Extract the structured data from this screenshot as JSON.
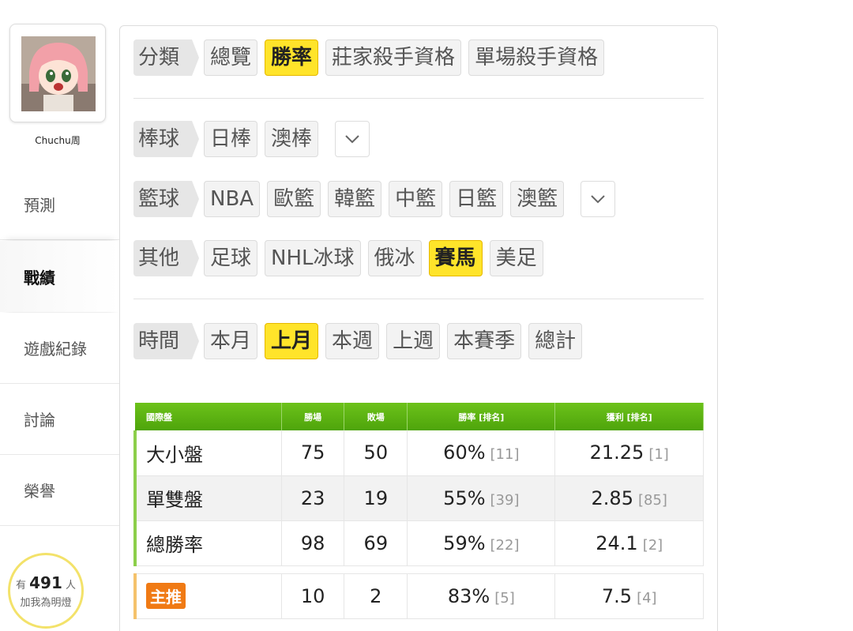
{
  "profile": {
    "username": "Chuchu周"
  },
  "nav": [
    {
      "label": "預測",
      "active": false
    },
    {
      "label": "戰績",
      "active": true
    },
    {
      "label": "遊戲紀錄",
      "active": false
    },
    {
      "label": "討論",
      "active": false
    },
    {
      "label": "榮譽",
      "active": false
    }
  ],
  "fans": {
    "prefix": "有",
    "count": "491",
    "suffix": "人",
    "line2": "加我為明燈"
  },
  "filters": {
    "category": {
      "label": "分類",
      "options": [
        "總覽",
        "勝率",
        "莊家殺手資格",
        "單場殺手資格"
      ],
      "selected": "勝率"
    },
    "baseball": {
      "label": "棒球",
      "options": [
        "日棒",
        "澳棒"
      ]
    },
    "basketball": {
      "label": "籃球",
      "options": [
        "NBA",
        "歐籃",
        "韓籃",
        "中籃",
        "日籃",
        "澳籃"
      ]
    },
    "other": {
      "label": "其他",
      "options": [
        "足球",
        "NHL冰球",
        "俄冰",
        "賽馬",
        "美足"
      ],
      "selected": "賽馬"
    },
    "time": {
      "label": "時間",
      "options": [
        "本月",
        "上月",
        "本週",
        "上週",
        "本賽季",
        "總計"
      ],
      "selected": "上月"
    }
  },
  "table": {
    "headers": [
      "國際盤",
      "勝場",
      "敗場",
      "勝率 [排名]",
      "獲利 [排名]"
    ],
    "rows": [
      {
        "name": "大小盤",
        "win": "75",
        "loss": "50",
        "rate": "60%",
        "rate_rank": "[11]",
        "profit": "21.25",
        "profit_rank": "[1]"
      },
      {
        "name": "單雙盤",
        "win": "23",
        "loss": "19",
        "rate": "55%",
        "rate_rank": "[39]",
        "profit": "2.85",
        "profit_rank": "[85]"
      },
      {
        "name": "總勝率",
        "win": "98",
        "loss": "69",
        "rate": "59%",
        "rate_rank": "[22]",
        "profit": "24.1",
        "profit_rank": "[2]"
      }
    ],
    "main_pick": {
      "badge": "主推",
      "win": "10",
      "loss": "2",
      "rate": "83%",
      "rate_rank": "[5]",
      "profit": "7.5",
      "profit_rank": "[4]"
    }
  },
  "colors": {
    "accent_yellow": "#ffe42a",
    "header_green": "#5cb314",
    "badge_orange": "#f07a14",
    "fans_ring": "#f3e26a"
  }
}
